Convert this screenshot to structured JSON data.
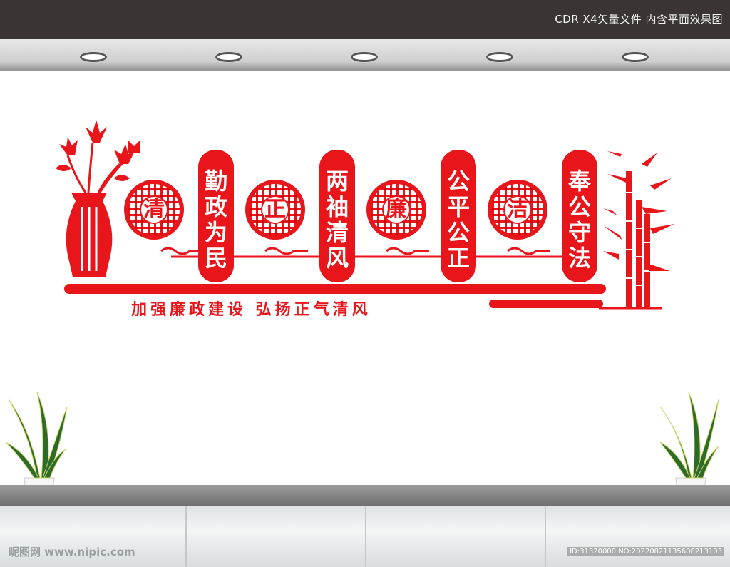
{
  "caption": "CDR X4矢量文件  内含平面效果图",
  "banners": [
    {
      "text": "勤政为民"
    },
    {
      "text": "两袖清风"
    },
    {
      "text": "公平公正"
    },
    {
      "text": "奉公守法"
    }
  ],
  "roundels": [
    {
      "char": "清"
    },
    {
      "char": "正"
    },
    {
      "char": "廉"
    },
    {
      "char": "洁"
    }
  ],
  "slogan": "加强廉政建设  弘扬正气清风",
  "watermark": "昵图网 www.nipic.com",
  "id_text": "ID:31320000 NO:20220821135608213103",
  "colors": {
    "accent": "#e8161b",
    "topbar": "#3a3434"
  }
}
